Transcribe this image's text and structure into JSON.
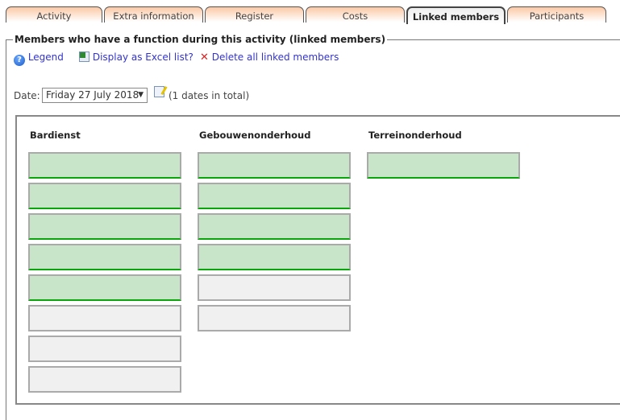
{
  "tabs": [
    {
      "label": "Activity",
      "active": false
    },
    {
      "label": "Extra information",
      "active": false
    },
    {
      "label": "Register",
      "active": false
    },
    {
      "label": "Costs",
      "active": false
    },
    {
      "label": "Linked members",
      "active": true
    },
    {
      "label": "Participants",
      "active": false
    }
  ],
  "section": {
    "legend": "Members who have a function during this activity (linked members)"
  },
  "actions": {
    "legend_label": "Legend",
    "excel_label": "Display as Excel list?",
    "delete_label": "Delete all linked members"
  },
  "date": {
    "label": "Date:",
    "selected": "Friday 27 July 2018",
    "total": "(1 dates in total)"
  },
  "functions": [
    {
      "name": "Bardienst",
      "slots": [
        "filled",
        "filled",
        "filled",
        "filled",
        "filled",
        "empty",
        "empty",
        "empty"
      ]
    },
    {
      "name": "Gebouwenonderhoud",
      "slots": [
        "filled",
        "filled",
        "filled",
        "filled",
        "empty",
        "empty"
      ]
    },
    {
      "name": "Terreinonderhoud",
      "slots": [
        "filled"
      ]
    }
  ],
  "colors": {
    "filled_slot": "#c9e5c9",
    "filled_border": "#0aa50a",
    "empty_slot": "#f0f0f0",
    "link": "#3333cc"
  }
}
